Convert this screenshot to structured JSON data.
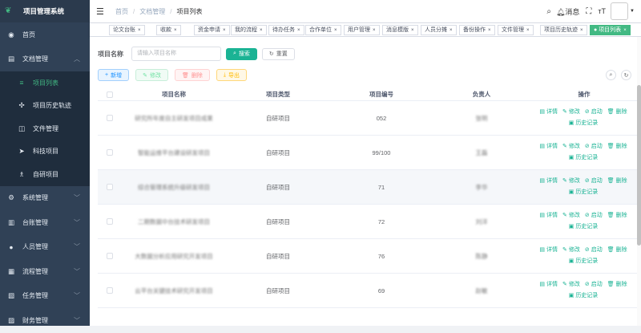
{
  "app": {
    "title": "项目管理系统"
  },
  "sidebar": {
    "items": [
      {
        "label": "首页",
        "icon": "dashboard-icon",
        "glyph": "◉",
        "expanded": false,
        "has_arrow": false
      },
      {
        "label": "文档管理",
        "icon": "document-icon",
        "glyph": "▤",
        "expanded": true,
        "has_arrow": true
      },
      {
        "label": "系统管理",
        "icon": "gear-icon",
        "glyph": "⚙",
        "expanded": false,
        "has_arrow": true
      },
      {
        "label": "台账管理",
        "icon": "ledger-icon",
        "glyph": "▥",
        "expanded": false,
        "has_arrow": true
      },
      {
        "label": "人员管理",
        "icon": "user-icon",
        "glyph": "●",
        "expanded": false,
        "has_arrow": true
      },
      {
        "label": "流程管理",
        "icon": "flow-icon",
        "glyph": "▦",
        "expanded": false,
        "has_arrow": true
      },
      {
        "label": "任务管理",
        "icon": "task-icon",
        "glyph": "▧",
        "expanded": false,
        "has_arrow": true
      },
      {
        "label": "财务管理",
        "icon": "finance-icon",
        "glyph": "▨",
        "expanded": false,
        "has_arrow": true
      }
    ],
    "submenu": [
      {
        "label": "项目列表",
        "icon": "list-icon",
        "glyph": "≡",
        "active": true
      },
      {
        "label": "项目历史轨迹",
        "icon": "move-icon",
        "glyph": "✣",
        "active": false
      },
      {
        "label": "文件管理",
        "icon": "file-icon",
        "glyph": "◫",
        "active": false
      },
      {
        "label": "科技项目",
        "icon": "send-icon",
        "glyph": "➤",
        "active": false
      },
      {
        "label": "自研项目",
        "icon": "tree-icon",
        "glyph": "♗",
        "active": false
      }
    ]
  },
  "navbar": {
    "breadcrumb": [
      "首页",
      "文档管理",
      "项目列表"
    ],
    "message_label": "消息"
  },
  "tags": [
    {
      "label": "论文台账",
      "active": false
    },
    {
      "label": "收款",
      "active": false
    },
    {
      "label": "资金申请",
      "active": false
    },
    {
      "label": "我的流程",
      "active": false
    },
    {
      "label": "待办任务",
      "active": false
    },
    {
      "label": "合作单位",
      "active": false
    },
    {
      "label": "用户管理",
      "active": false
    },
    {
      "label": "消息模版",
      "active": false
    },
    {
      "label": "人员分摊",
      "active": false
    },
    {
      "label": "备份操作",
      "active": false
    },
    {
      "label": "文件管理",
      "active": false
    },
    {
      "label": "项目历史轨迹",
      "active": false
    },
    {
      "label": "项目列表",
      "active": true
    }
  ],
  "search": {
    "label": "项目名称",
    "placeholder": "请输入项目名称",
    "search_button": "搜索",
    "reset_button": "重置"
  },
  "toolbar": {
    "add": "新增",
    "edit": "修改",
    "delete": "删除",
    "export": "导出"
  },
  "table": {
    "headers": [
      "项目名称",
      "项目类型",
      "项目编号",
      "负责人",
      "操作"
    ],
    "ops": {
      "detail": "详情",
      "edit": "修改",
      "start": "启动",
      "delete": "删除",
      "history": "历史记录"
    },
    "rows": [
      {
        "name": "研究所年度自主研发项目成果",
        "type": "自研项目",
        "code": "052",
        "owner": "张明"
      },
      {
        "name": "智能运维平台建设研发项目",
        "type": "自研项目",
        "code": "99/100",
        "owner": "王磊"
      },
      {
        "name": "综合管理系统升级研发项目",
        "type": "自研项目",
        "code": "71",
        "owner": "李华"
      },
      {
        "name": "二期数据中台技术研发项目",
        "type": "自研项目",
        "code": "72",
        "owner": "刘洋"
      },
      {
        "name": "大数据分析应用研究开发项目",
        "type": "自研项目",
        "code": "76",
        "owner": "陈静"
      },
      {
        "name": "云平台关键技术研究开发项目",
        "type": "自研项目",
        "code": "69",
        "owner": "赵敏"
      }
    ]
  },
  "colors": {
    "accent": "#1ab394",
    "sidebar_bg": "#304156",
    "active_menu": "#42b983"
  }
}
